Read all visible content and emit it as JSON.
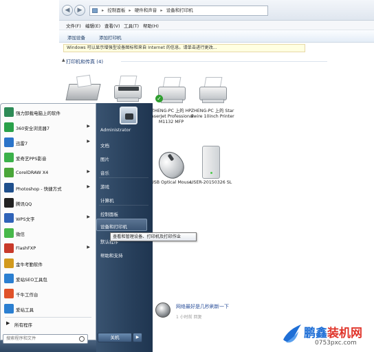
{
  "explorer": {
    "nav_back": "◀",
    "nav_forward": "▶",
    "address_crumbs": [
      "控制面板",
      "硬件和声音",
      "设备和打印机"
    ],
    "menu": [
      "文件(F)",
      "编辑(E)",
      "查看(V)",
      "工具(T)",
      "帮助(H)"
    ],
    "toolbar": [
      "添加设备",
      "添加打印机"
    ],
    "infobar": "Windows 可以显示增强型设备图标和来自 Internet 的信息。请单击进行更改...",
    "group_header": "打印机和传真 (4)",
    "group_toggle": "▲",
    "devices": [
      {
        "label": ""
      },
      {
        "label": ""
      },
      {
        "label": "ZHENG-PC 上的 HP LaserJet Professional M1132 MFP"
      },
      {
        "label": "ZHENG-PC 上的 Star 9wire 10inch Printer"
      },
      {
        "label": "USB Optical Mouse"
      },
      {
        "label": "USER-20150326 SL"
      }
    ]
  },
  "start_menu": {
    "programs": [
      {
        "label": "强力卸载电脑上的软件",
        "arrow": "",
        "color": "#2e8b57"
      },
      {
        "label": "360安全浏览器7",
        "arrow": "▶",
        "color": "#2aa14a"
      },
      {
        "label": "迅雷7",
        "arrow": "▶",
        "color": "#2b74c9"
      },
      {
        "label": "爱奇艺PPS影音",
        "arrow": "",
        "color": "#3bb14a"
      },
      {
        "label": "CorelDRAW X4",
        "arrow": "▶",
        "color": "#4aa63a"
      },
      {
        "label": "Photoshop - 快捷方式",
        "arrow": "▶",
        "color": "#1e4f8c"
      },
      {
        "label": "腾讯QQ",
        "arrow": "",
        "color": "#222222"
      },
      {
        "label": "WPS文字",
        "arrow": "▶",
        "color": "#2f63b8"
      },
      {
        "label": "微信",
        "arrow": "",
        "color": "#47b84a"
      },
      {
        "label": "FlashFXP",
        "arrow": "▶",
        "color": "#c83a2a"
      },
      {
        "label": "金牛考勤软件",
        "arrow": "",
        "color": "#d29a1e"
      },
      {
        "label": "爱站SEO工具包",
        "arrow": "",
        "color": "#2b7fd1"
      },
      {
        "label": "千牛工作台",
        "arrow": "",
        "color": "#e0522a"
      },
      {
        "label": "爱站工具",
        "arrow": "",
        "color": "#2b7fd1"
      }
    ],
    "all_programs_arrow": "▶",
    "all_programs": "所有程序",
    "search_placeholder": "搜索程序和文件",
    "right_items": [
      "Administrator",
      "文档",
      "图片",
      "音乐",
      "游戏",
      "计算机",
      "控制面板",
      "设备和打印机",
      "默认程序",
      "帮助和支持"
    ],
    "tooltip": "查看和管理设备、打印机及打印作业",
    "shutdown": "关机",
    "shutdown_arrow": "▶"
  },
  "overlay": {
    "ad_text": "网络最好是几秒刷新一下",
    "ad_meta": "1 小时前     回复",
    "watermark_cn": "鹏鑫装机网",
    "watermark_cn_colors": [
      "#1f6fd6",
      "#e0352b"
    ],
    "watermark_url": "0753pxc.com"
  }
}
